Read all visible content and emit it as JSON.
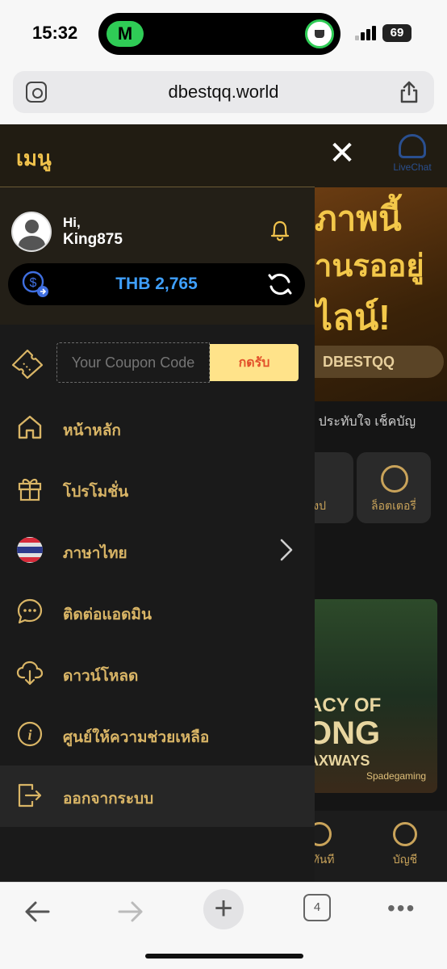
{
  "status": {
    "time": "15:32",
    "island_app": "M",
    "battery": "69"
  },
  "browser": {
    "url": "dbestqq.world",
    "tab_count": "4"
  },
  "background": {
    "livechat": "LiveChat",
    "banner_lines": [
      "ภาพนี้",
      "านรออยู่",
      "ไลน์!"
    ],
    "banner_pill": "DBESTQQ",
    "marquee": "บ ประทับใจ เช็คบัญ",
    "categories": [
      "ยิงป",
      "ล็อตเตอรี่"
    ],
    "game": {
      "line1": "ACY OF",
      "line2": "ONG",
      "line3": "AXWAYS",
      "provider": "Spadegaming"
    },
    "bottom_nav": [
      "แทันที",
      "บัญชี"
    ]
  },
  "drawer": {
    "title": "เมนู",
    "greeting": "Hi,",
    "username": "King875",
    "balance": "THB 2,765",
    "coupon": {
      "placeholder": "Your Coupon Code",
      "button": "กดรับ"
    },
    "items": [
      {
        "label": "หน้าหลัก",
        "icon": "home-icon"
      },
      {
        "label": "โปรโมชั่น",
        "icon": "gift-icon"
      },
      {
        "label": "ภาษาไทย",
        "icon": "thai-flag-icon"
      },
      {
        "label": "ติดต่อแอดมิน",
        "icon": "chat-icon"
      },
      {
        "label": "ดาวน์โหลด",
        "icon": "cloud-download-icon"
      },
      {
        "label": "ศูนย์ให้ความช่วยเหลือ",
        "icon": "info-icon"
      },
      {
        "label": "ออกจากระบบ",
        "icon": "logout-icon"
      }
    ]
  },
  "colors": {
    "gold": "#d9b566",
    "accent": "#f0c24c",
    "balance": "#3fa0ff",
    "coupon_btn": "#ffe38a"
  }
}
